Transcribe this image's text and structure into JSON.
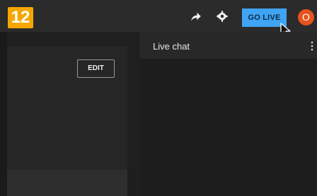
{
  "step_number": "12",
  "header": {
    "go_live_label": "GO LIVE",
    "avatar_initial": "O"
  },
  "studio": {
    "edit_label": "EDIT"
  },
  "chat": {
    "title": "Live chat"
  },
  "colors": {
    "accent_badge": "#f5a700",
    "go_live_button": "#3fa4f4",
    "avatar_background": "#e5531e"
  },
  "icons": {
    "share": "share-icon",
    "settings": "gear-icon",
    "menu": "more-vertical-icon",
    "cursor": "mouse-pointer-icon"
  }
}
